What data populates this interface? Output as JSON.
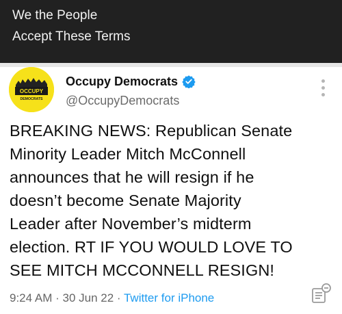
{
  "caption": {
    "line1": "We the People",
    "line2": "Accept These Terms"
  },
  "tweet": {
    "avatar": {
      "logo_text_top": "OCCUPY",
      "logo_text_bottom": "DEMOCRATS",
      "background_color": "#f6e11a"
    },
    "author_name": "Occupy Democrats",
    "handle": "@OccupyDemocrats",
    "verified_icon": "verified-badge-icon",
    "more_icon": "more-options-icon",
    "text_lines": [
      "BREAKING NEWS: Republican Senate",
      "Minority Leader Mitch McConnell",
      "announces that he will resign if he",
      "doesn’t become Senate Majority",
      "Leader after November’s midterm",
      "election. RT IF YOU WOULD LOVE TO",
      "SEE MITCH MCCONNELL RESIGN!"
    ],
    "time": "9:24 AM",
    "sep1": " · ",
    "date": "30 Jun 22",
    "sep2": " · ",
    "source": "Twitter for iPhone",
    "analytics_icon": "analytics-icon",
    "accent_color": "#1d9bf0"
  }
}
